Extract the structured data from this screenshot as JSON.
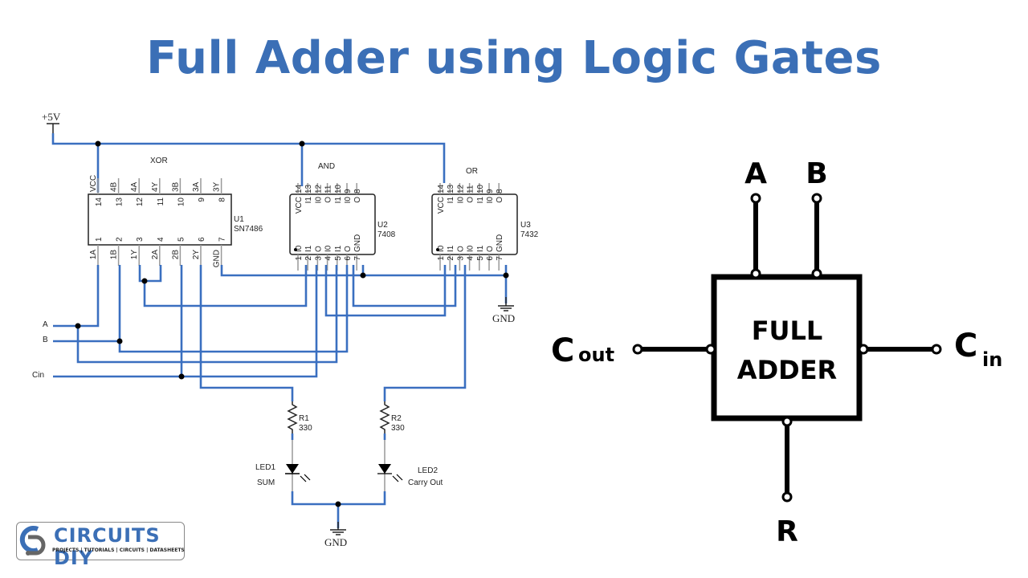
{
  "title": "Full Adder using Logic Gates",
  "schematic": {
    "supply_label": "+5V",
    "ground_label": "GND",
    "inputs": [
      "A",
      "B",
      "Cin"
    ],
    "chips": [
      {
        "ref": "U1",
        "part": "SN7486",
        "function": "XOR",
        "top_pins": [
          "14",
          "13",
          "12",
          "11",
          "10",
          "9",
          "8"
        ],
        "top_names": [
          "VCC",
          "4B",
          "4A",
          "4Y",
          "3B",
          "3A",
          "3Y"
        ],
        "bottom_pins": [
          "1",
          "2",
          "3",
          "4",
          "5",
          "6",
          "7"
        ],
        "bottom_names": [
          "1A",
          "1B",
          "1Y",
          "2A",
          "2B",
          "2Y",
          "GND"
        ]
      },
      {
        "ref": "U2",
        "part": "7408",
        "function": "AND",
        "top_pins": [
          "14",
          "13",
          "12",
          "11",
          "10",
          "9",
          "8"
        ],
        "top_names": [
          "VCC",
          "I1",
          "I0",
          "O",
          "I1",
          "I0",
          "O"
        ],
        "bottom_pins": [
          "1",
          "2",
          "3",
          "4",
          "5",
          "6",
          "7"
        ],
        "bottom_names": [
          "I0",
          "I1",
          "O",
          "I0",
          "I1",
          "O",
          "GND"
        ]
      },
      {
        "ref": "U3",
        "part": "7432",
        "function": "OR",
        "top_pins": [
          "14",
          "13",
          "12",
          "11",
          "10",
          "9",
          "8"
        ],
        "top_names": [
          "VCC",
          "I1",
          "I0",
          "O",
          "I1",
          "I0",
          "O"
        ],
        "bottom_pins": [
          "1",
          "2",
          "3",
          "4",
          "5",
          "6",
          "7"
        ],
        "bottom_names": [
          "I0",
          "I1",
          "O",
          "I0",
          "I1",
          "O",
          "GND"
        ]
      }
    ],
    "resistors": [
      {
        "ref": "R1",
        "value": "330"
      },
      {
        "ref": "R2",
        "value": "330"
      }
    ],
    "leds": [
      {
        "ref": "LED1",
        "label": "SUM"
      },
      {
        "ref": "LED2",
        "label": "Carry Out"
      }
    ]
  },
  "block": {
    "line1": "FULL",
    "line2": "ADDER",
    "input_a": "A",
    "input_b": "B",
    "cout_main": "C",
    "cout_sub": "out",
    "cin_main": "C",
    "cin_sub": "in",
    "output_r": "R"
  },
  "logo": {
    "name": "CIRCUITS DIY",
    "tagline": "PROJECTS | TUTORIALS | CIRCUITS | DATASHEETS",
    "color": "#3b6fb6"
  }
}
